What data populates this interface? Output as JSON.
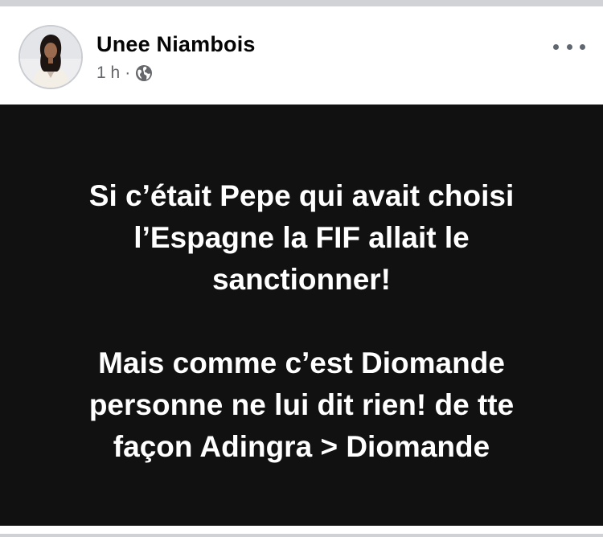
{
  "post": {
    "author": "Unee Niambois",
    "time": "1 h",
    "separator": "·",
    "privacy_icon": "globe-icon",
    "more_icon": "more-horizontal-icon",
    "avatar_icon": "profile-photo",
    "text_paragraph_1": [
      "Si c’était Pepe qui avait choisi",
      "l’Espagne la FIF allait le",
      "sanctionner!"
    ],
    "text_paragraph_2": [
      "Mais comme c’est Diomande",
      "personne ne lui dit rien! de tte",
      "façon Adingra > Diomande"
    ]
  },
  "colors": {
    "panel_background": "#111111",
    "panel_text": "#ffffff",
    "name_text": "#050505",
    "meta_text": "#65676b"
  }
}
